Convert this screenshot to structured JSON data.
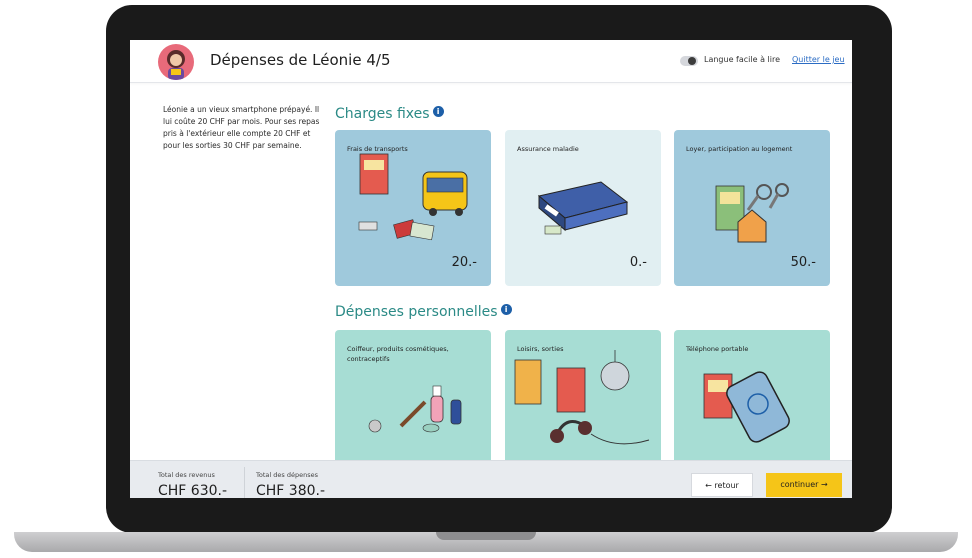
{
  "header": {
    "title": "Dépenses de Léonie 4/5",
    "easy_read_label": "Langue facile à lire",
    "quit_label": "Quitter le jeu"
  },
  "description": "Léonie a un vieux smartphone prépayé. Il lui coûte 20 CHF par mois. Pour ses repas pris à l'extérieur elle compte 20 CHF et pour les sorties 30 CHF par semaine.",
  "sections": {
    "fixed": {
      "title": "Charges fixes",
      "info_icon": "i",
      "cards": [
        {
          "label": "Frais de transports",
          "amount": "20.-"
        },
        {
          "label": "Assurance maladie",
          "amount": "0.-"
        },
        {
          "label": "Loyer, participation au logement",
          "amount": "50.-"
        }
      ]
    },
    "personal": {
      "title": "Dépenses personnelles",
      "info_icon": "i",
      "cards": [
        {
          "label": "Coiffeur, produits cosmétiques, contraceptifs"
        },
        {
          "label": "Loisirs, sorties"
        },
        {
          "label": "Téléphone portable"
        }
      ]
    }
  },
  "footer": {
    "income_label": "Total des revenus",
    "income_value": "CHF 630.-",
    "expenses_label": "Total des dépenses",
    "expenses_value": "CHF 380.-",
    "back_label": "← retour",
    "next_label": "continuer →"
  },
  "colors": {
    "accent_teal": "#2b8a86",
    "card_blue": "#9fc9dc",
    "card_teal": "#a7ddd4",
    "button_yellow": "#f5c518",
    "link_blue": "#2b6cc4"
  }
}
